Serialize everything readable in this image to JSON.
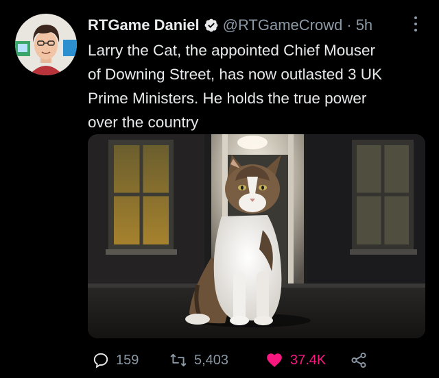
{
  "author": {
    "display_name": "RTGame Daniel",
    "handle": "@RTGameCrowd",
    "separator": "·",
    "time": "5h",
    "verified": true
  },
  "tweet": {
    "lines": [
      "Larry the Cat, the appointed Chief Mouser",
      "of Downing Street, has now outlasted 3 UK",
      "Prime Ministers. He holds the true power",
      "over the country"
    ]
  },
  "actions": {
    "replies": "159",
    "retweets": "5,403",
    "likes": "37.4K",
    "liked": true
  },
  "colors": {
    "background": "#000000",
    "text": "#e7e9ea",
    "muted": "#8b98a5",
    "like": "#f91880",
    "verified": "#e7e9ea"
  },
  "icons": [
    "verified-badge-icon",
    "more-icon",
    "reply-icon",
    "retweet-icon",
    "heart-icon",
    "share-icon"
  ]
}
